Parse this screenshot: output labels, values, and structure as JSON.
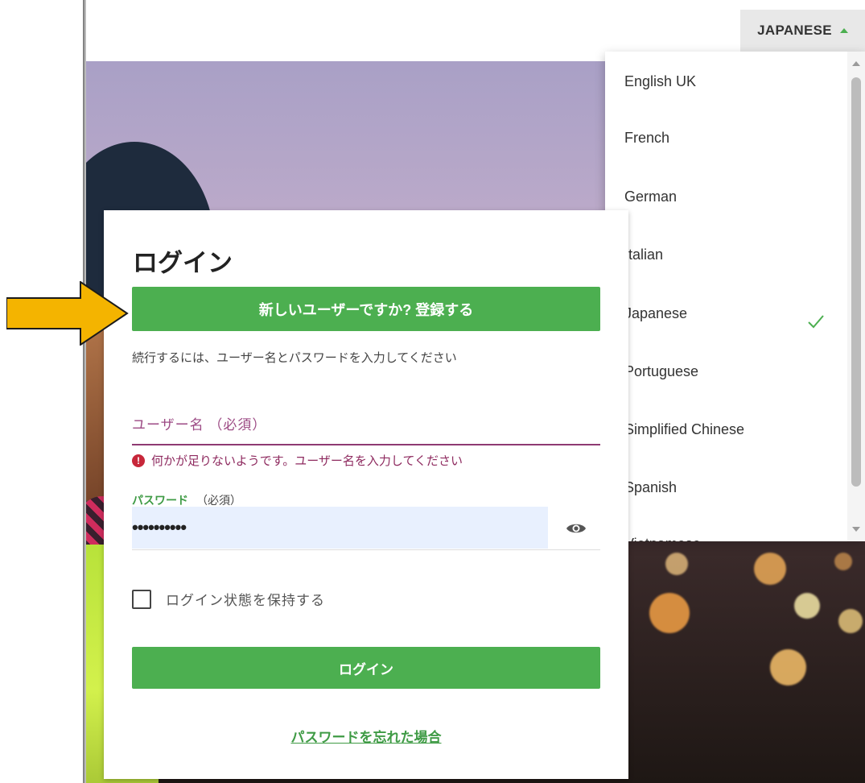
{
  "language_selector": {
    "current_label": "JAPANESE",
    "options": [
      "English UK",
      "French",
      "German",
      "Italian",
      "Japanese",
      "Portuguese",
      "Simplified Chinese",
      "Spanish",
      "Vietnamese"
    ],
    "selected": "Japanese"
  },
  "login": {
    "title": "ログイン",
    "register_button": "新しいユーザーですか? 登録する",
    "instructions": "続行するには、ユーザー名とパスワードを入力してください",
    "username_placeholder": "ユーザー名",
    "username_required": "（必須）",
    "username_error": "何かが足りないようです。ユーザー名を入力してください",
    "password_label": "パスワード",
    "password_required": "（必須）",
    "password_value": "••••••••••",
    "remember_label": "ログイン状態を保持する",
    "login_button": "ログイン",
    "forgot_link": "パスワードを忘れた場合"
  },
  "colors": {
    "accent_green": "#4caf50",
    "error_magenta": "#8e3a73",
    "annotation_arrow": "#f4b400"
  },
  "icons": {
    "error": "exclamation-circle-icon",
    "password_toggle": "eye-icon",
    "selected": "checkmark-icon",
    "dropdown": "caret-up-icon",
    "annotation": "arrow-right-icon"
  }
}
